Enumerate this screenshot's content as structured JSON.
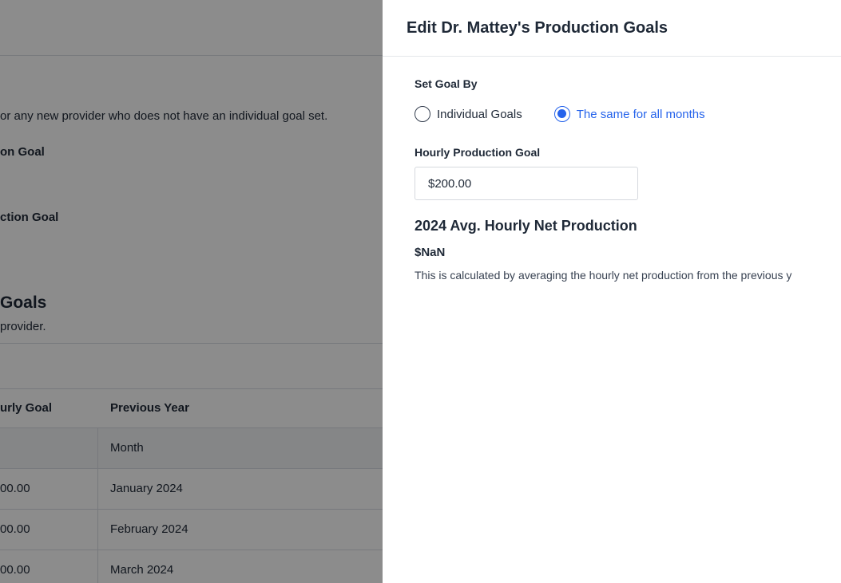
{
  "background": {
    "intro_text": "or any new provider who does not have an individual goal set.",
    "goal_label_1": "on Goal",
    "goal_label_2": "ction Goal",
    "section_heading": "Goals",
    "section_sub": "provider.",
    "table": {
      "col_hourly_goal": "urly Goal",
      "col_previous_year": "Previous Year",
      "subheader_month": "Month",
      "rows": [
        {
          "goal": "00.00",
          "month": "January 2024"
        },
        {
          "goal": "00.00",
          "month": "February 2024"
        },
        {
          "goal": "00.00",
          "month": "March 2024"
        }
      ]
    }
  },
  "drawer": {
    "title": "Edit Dr. Mattey's Production Goals",
    "set_goal_by_label": "Set Goal By",
    "options": {
      "individual": "Individual Goals",
      "same_all": "The same for all months",
      "selected": "same_all"
    },
    "hourly_goal_label": "Hourly Production Goal",
    "hourly_goal_value": "$200.00",
    "avg_title": "2024 Avg. Hourly Net Production",
    "avg_value": "$NaN",
    "avg_description": "This is calculated by averaging the hourly net production from the previous y"
  },
  "colors": {
    "accent": "#2563eb",
    "overlay": "rgba(0,0,0,0.45)"
  }
}
